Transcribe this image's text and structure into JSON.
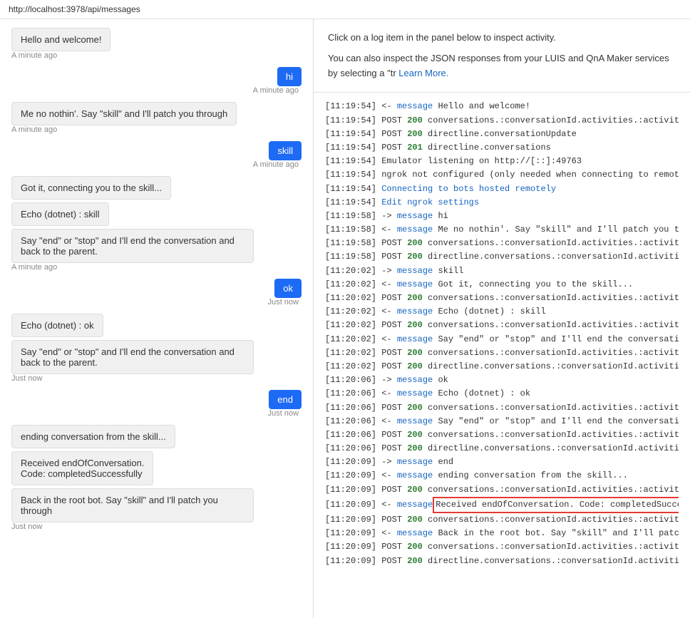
{
  "topbar": {
    "url": "http://localhost:3978/api/messages"
  },
  "inspector": {
    "description_line1": "Click on a log item in the panel below to inspect activity.",
    "description_line2": "You can also inspect the JSON responses from your LUIS and QnA Maker services by selecting a \"tr",
    "learn_more": "Learn More."
  },
  "chat": {
    "messages": [
      {
        "id": "m1",
        "type": "bot",
        "text": "Hello and welcome!",
        "timestamp": "A minute ago"
      },
      {
        "id": "m2",
        "type": "user",
        "text": "hi",
        "timestamp": "A minute ago"
      },
      {
        "id": "m3",
        "type": "bot",
        "text": "Me no nothin'. Say \"skill\" and I'll patch you through",
        "timestamp": "A minute ago"
      },
      {
        "id": "m4",
        "type": "user",
        "text": "skill",
        "timestamp": "A minute ago"
      },
      {
        "id": "m5a",
        "type": "bot",
        "text": "Got it, connecting you to the skill...",
        "timestamp": null
      },
      {
        "id": "m5b",
        "type": "bot",
        "text": "Echo (dotnet) : skill",
        "timestamp": null
      },
      {
        "id": "m5c",
        "type": "bot",
        "text": "Say \"end\" or \"stop\" and I'll end the conversation and back to the parent.",
        "timestamp": "A minute ago"
      },
      {
        "id": "m6",
        "type": "user",
        "text": "ok",
        "timestamp": "Just now"
      },
      {
        "id": "m7a",
        "type": "bot",
        "text": "Echo (dotnet) : ok",
        "timestamp": null
      },
      {
        "id": "m7b",
        "type": "bot",
        "text": "Say \"end\" or \"stop\" and I'll end the conversation and back to the parent.",
        "timestamp": "Just now"
      },
      {
        "id": "m8",
        "type": "user",
        "text": "end",
        "timestamp": "Just now"
      },
      {
        "id": "m9a",
        "type": "bot",
        "text": "ending conversation from the skill...",
        "timestamp": null
      },
      {
        "id": "m9b",
        "type": "bot",
        "text": "Received endOfConversation.\nCode: completedSuccessfully",
        "timestamp": null
      },
      {
        "id": "m9c",
        "type": "bot",
        "text": "Back in the root bot. Say \"skill\" and I'll patch you through",
        "timestamp": "Just now"
      }
    ]
  },
  "logs": [
    {
      "time": "[11:19:54]",
      "dir": "<-",
      "type": "message",
      "text": " Hello and welcome!",
      "highlight": false
    },
    {
      "time": "[11:19:54]",
      "dir": "POST",
      "status": "200",
      "text": " conversations.:conversationId.activities.:activityId",
      "highlight": false
    },
    {
      "time": "[11:19:54]",
      "dir": "POST",
      "status": "200",
      "text": " directline.conversationUpdate",
      "highlight": false
    },
    {
      "time": "[11:19:54]",
      "dir": "POST",
      "status": "201",
      "text": " directline.conversations",
      "highlight": false
    },
    {
      "time": "[11:19:54]",
      "dir": null,
      "status": null,
      "text": " Emulator listening on http://[::]:49763",
      "highlight": false
    },
    {
      "time": "[11:19:54]",
      "dir": null,
      "status": null,
      "text": " ngrok not configured (only needed when connecting to remotely hoste",
      "highlight": false
    },
    {
      "time": "[11:19:54]",
      "dir": "link",
      "text": " Connecting to bots hosted remotely",
      "highlight": false
    },
    {
      "time": "[11:19:54]",
      "dir": "link",
      "text": " Edit ngrok settings",
      "highlight": false
    },
    {
      "time": "[11:19:58]",
      "dir": "->",
      "type": "message",
      "text": " hi",
      "highlight": false
    },
    {
      "time": "[11:19:58]",
      "dir": "<-",
      "type": "message",
      "text": " Me no nothin'. Say \"skill\" and I'll patch you thro...",
      "highlight": false
    },
    {
      "time": "[11:19:58]",
      "dir": "POST",
      "status": "200",
      "text": " conversations.:conversationId.activities.:activityId",
      "highlight": false
    },
    {
      "time": "[11:19:58]",
      "dir": "POST",
      "status": "200",
      "text": " directline.conversations.:conversationId.activities",
      "highlight": false
    },
    {
      "time": "[11:20:02]",
      "dir": "->",
      "type": "message",
      "text": " skill",
      "highlight": false
    },
    {
      "time": "[11:20:02]",
      "dir": "<-",
      "type": "message",
      "text": " Got it, connecting you to the skill...",
      "highlight": false
    },
    {
      "time": "[11:20:02]",
      "dir": "POST",
      "status": "200",
      "text": " conversations.:conversationId.activities.:activityId",
      "highlight": false
    },
    {
      "time": "[11:20:02]",
      "dir": "<-",
      "type": "message",
      "text": " Echo (dotnet) : skill",
      "highlight": false
    },
    {
      "time": "[11:20:02]",
      "dir": "POST",
      "status": "200",
      "text": " conversations.:conversationId.activities.:activityId",
      "highlight": false
    },
    {
      "time": "[11:20:02]",
      "dir": "<-",
      "type": "message",
      "text": " Say \"end\" or \"stop\" and I'll end the conversation ...",
      "highlight": false
    },
    {
      "time": "[11:20:02]",
      "dir": "POST",
      "status": "200",
      "text": " conversations.:conversationId.activities.:activityId",
      "highlight": false
    },
    {
      "time": "[11:20:02]",
      "dir": "POST",
      "status": "200",
      "text": " directline.conversations.:conversationId.activities",
      "highlight": false
    },
    {
      "time": "[11:20:06]",
      "dir": "->",
      "type": "message",
      "text": " ok",
      "highlight": false
    },
    {
      "time": "[11:20:06]",
      "dir": "<-",
      "type": "message",
      "text": " Echo (dotnet) : ok",
      "highlight": false
    },
    {
      "time": "[11:20:06]",
      "dir": "POST",
      "status": "200",
      "text": " conversations.:conversationId.activities.:activityId",
      "highlight": false
    },
    {
      "time": "[11:20:06]",
      "dir": "<-",
      "type": "message",
      "text": " Say \"end\" or \"stop\" and I'll end the conversation ...",
      "highlight": false
    },
    {
      "time": "[11:20:06]",
      "dir": "POST",
      "status": "200",
      "text": " conversations.:conversationId.activities.:activityId",
      "highlight": false
    },
    {
      "time": "[11:20:06]",
      "dir": "POST",
      "status": "200",
      "text": " directline.conversations.:conversationId.activities",
      "highlight": false
    },
    {
      "time": "[11:20:09]",
      "dir": "->",
      "type": "message",
      "text": " end",
      "highlight": false
    },
    {
      "time": "[11:20:09]",
      "dir": "<-",
      "type": "message",
      "text": " ending conversation from the skill...",
      "highlight": false
    },
    {
      "time": "[11:20:09]",
      "dir": "POST",
      "status": "200",
      "text": " conversations.:conversationId.activities.:activityId",
      "highlight": false
    },
    {
      "time": "[11:20:09]",
      "dir": "<-",
      "type": "message",
      "text": " Received endOfConversation. Code: completedSucces...",
      "highlight": true
    },
    {
      "time": "[11:20:09]",
      "dir": "POST",
      "status": "200",
      "text": " conversations.:conversationId.activities.:activityId",
      "highlight": false
    },
    {
      "time": "[11:20:09]",
      "dir": "<-",
      "type": "message",
      "text": " Back in the root bot. Say \"skill\" and I'll patch y...",
      "highlight": false
    },
    {
      "time": "[11:20:09]",
      "dir": "POST",
      "status": "200",
      "text": " conversations.:conversationId.activities.:activityId",
      "highlight": false
    },
    {
      "time": "[11:20:09]",
      "dir": "POST",
      "status": "200",
      "text": " directline.conversations.:conversationId.activities",
      "highlight": false
    }
  ],
  "labels": {
    "connecting_link": "Connecting to bots hosted remotely",
    "ngrok_link": "Edit ngrok settings",
    "learn_more": "Learn More.",
    "message_keyword": "message",
    "post_keyword": "POST"
  }
}
